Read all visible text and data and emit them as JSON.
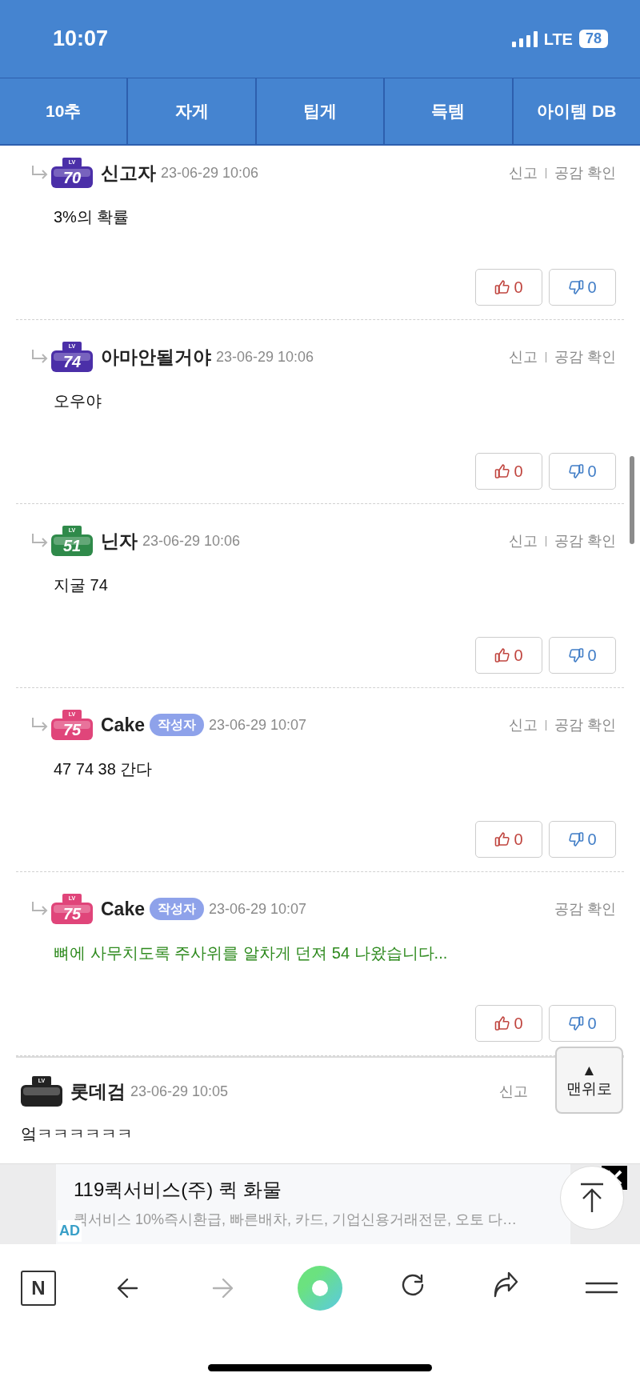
{
  "status_bar": {
    "time": "10:07",
    "network": "LTE",
    "battery": "78"
  },
  "tabs": [
    {
      "label": "10추"
    },
    {
      "label": "자게"
    },
    {
      "label": "팁게"
    },
    {
      "label": "득템"
    },
    {
      "label": "아이템 DB"
    }
  ],
  "comments": [
    {
      "kind": "reply",
      "badge": {
        "label": "LV",
        "level": "70",
        "color": "#4b2fa8"
      },
      "author": "신고자",
      "date": "23-06-29 10:06",
      "actions": [
        "신고",
        "공감 확인"
      ],
      "text": "3%의 확률",
      "votes": {
        "up": "0",
        "down": "0"
      }
    },
    {
      "kind": "reply",
      "badge": {
        "label": "LV",
        "level": "74",
        "color": "#4b2fa8"
      },
      "author": "아마안될거야",
      "date": "23-06-29 10:06",
      "actions": [
        "신고",
        "공감 확인"
      ],
      "text": "오우야",
      "votes": {
        "up": "0",
        "down": "0"
      }
    },
    {
      "kind": "reply",
      "badge": {
        "label": "LV",
        "level": "51",
        "color": "#2f8a4a"
      },
      "author": "닌자",
      "date": "23-06-29 10:06",
      "actions": [
        "신고",
        "공감 확인"
      ],
      "text": "지굴 74",
      "votes": {
        "up": "0",
        "down": "0"
      }
    },
    {
      "kind": "reply",
      "badge": {
        "label": "LV",
        "level": "75",
        "color": "#e0457a"
      },
      "author": "Cake",
      "author_tag": "작성자",
      "date": "23-06-29 10:07",
      "actions": [
        "신고",
        "공감 확인"
      ],
      "text": "47 74 38 간다",
      "votes": {
        "up": "0",
        "down": "0"
      }
    },
    {
      "kind": "reply",
      "badge": {
        "label": "LV",
        "level": "75",
        "color": "#e0457a"
      },
      "author": "Cake",
      "author_tag": "작성자",
      "date": "23-06-29 10:07",
      "actions": [
        "공감 확인"
      ],
      "text": "뼈에 사무치도록 주사위를 알차게 던져 54 나왔습니다...",
      "color": "#2e8a1e",
      "votes": {
        "up": "0",
        "down": "0"
      }
    },
    {
      "kind": "comment",
      "badge": {
        "label": "LV",
        "color": "#222222"
      },
      "author": "롯데검",
      "date": "23-06-29 10:05",
      "actions": [
        "신고"
      ],
      "text": "엌ㅋㅋㅋㅋㅋㅋ"
    }
  ],
  "back_to_top": {
    "arrow": "▲",
    "label": "맨위로"
  },
  "ad": {
    "title": "119퀵서비스(주) 퀵 화물",
    "description": "퀵서비스 10%즉시환급, 빠른배차, 카드, 기업신용거래전문, 오토 다…",
    "tag": "AD"
  },
  "toolbar": {
    "home_letter": "N"
  }
}
